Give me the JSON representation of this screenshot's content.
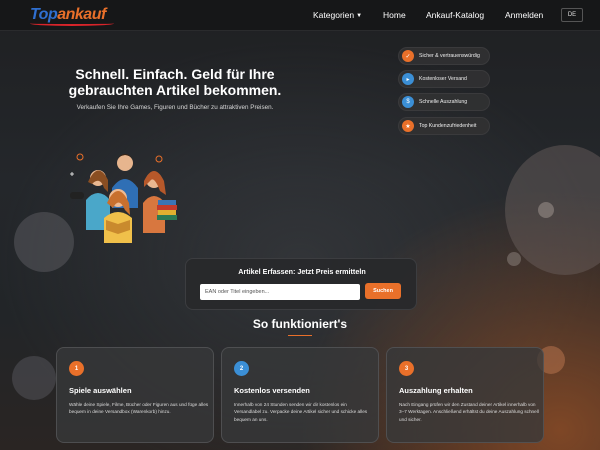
{
  "nav": {
    "logo_part1": "Top",
    "logo_part2": "ankauf",
    "items": [
      "Kategorien",
      "Home",
      "Ankauf-Katalog",
      "Anmelden"
    ],
    "language": "DE"
  },
  "hero": {
    "title": "Schnell. Einfach. Geld für Ihre gebrauchten Artikel bekommen.",
    "subtitle": "Verkaufen Sie Ihre Games, Figuren und Bücher zu attraktiven Preisen."
  },
  "features": [
    {
      "label": "Sicher & vertrauenswürdig",
      "icon": "shield-icon"
    },
    {
      "label": "Kostenloser Versand",
      "icon": "truck-icon"
    },
    {
      "label": "Schnelle Auszahlung",
      "icon": "coins-icon"
    },
    {
      "label": "Top Kundenzufriedenheit",
      "icon": "thumbs-up-icon"
    }
  ],
  "search": {
    "title": "Artikel Erfassen: Jetzt Preis ermitteln",
    "placeholder": "EAN oder Titel eingeben...",
    "button": "Suchen"
  },
  "how": {
    "title": "So funktioniert's",
    "steps": [
      {
        "num": "1",
        "title": "Spiele auswählen",
        "text": "Wähle deine Spiele, Filme, Bücher oder Figuren aus und füge alles bequem in deine Versandbox (Warenkorb) hinzu."
      },
      {
        "num": "2",
        "title": "Kostenlos versenden",
        "text": "Innerhalb von 24 Stunden senden wir dir kostenlos ein Versandlabel zu. Verpacke deine Artikel sicher und schicke alles bequem an uns."
      },
      {
        "num": "3",
        "title": "Auszahlung erhalten",
        "text": "Nach Eingang prüfen wir den Zustand deiner Artikel innerhalb von 3–7 Werktagen. Anschließend erhältst du deine Auszahlung schnell und sicher."
      }
    ]
  },
  "colors": {
    "accent": "#e9702a",
    "logo_blue": "#2f6fd0",
    "background": "#222528"
  }
}
